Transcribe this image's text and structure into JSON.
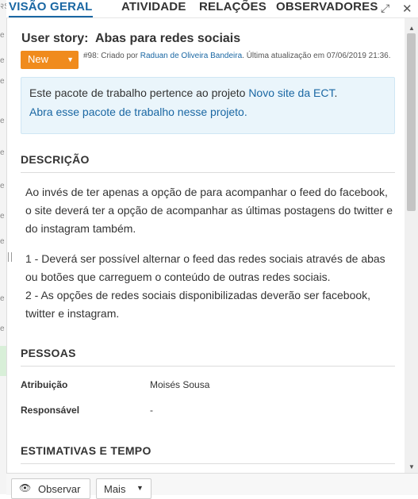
{
  "tabs": {
    "overview": "VISÃO GERAL",
    "activity": "ATIVIDADE",
    "relations": "RELAÇÕES",
    "watchers": "OBSERVADORES"
  },
  "header": {
    "type": "User story:",
    "title": "Abas para redes sociais"
  },
  "status": {
    "label": "New",
    "color": "#f08b1d"
  },
  "meta": {
    "prefix": "#98: Criado por ",
    "author": "Raduan de Oliveira Bandeira",
    "updated": ". Última atualização em 07/06/2019 21:36."
  },
  "notice": {
    "line1_prefix": "Este pacote de trabalho pertence ao projeto ",
    "project": "Novo site da ECT",
    "line1_suffix": ".",
    "open_link": "Abra esse pacote de trabalho nesse projeto."
  },
  "description": {
    "heading": "DESCRIÇÃO",
    "p1": "Ao invés de ter apenas a opção de para acompanhar o feed do facebook, o site deverá ter a opção de acompanhar as últimas postagens do twitter e do instagram também.",
    "p2_line1": "1 - Deverá ser possível alternar o feed das redes sociais através de abas ou botões que carreguem o conteúdo de outras redes sociais.",
    "p2_line2": "2 - As opções de redes sociais disponibilizadas deverão ser facebook, twitter e instagram."
  },
  "people": {
    "heading": "PESSOAS",
    "assignee_label": "Atribuição",
    "assignee_value": "Moisés Sousa",
    "responsible_label": "Responsável",
    "responsible_value": "-"
  },
  "estimates": {
    "heading": "ESTIMATIVAS E TEMPO"
  },
  "footer": {
    "watch_label": "Observar",
    "more_label": "Mais"
  },
  "left_edge": {
    "marks": [
      "२S",
      "e",
      "e",
      "e",
      "e",
      "e",
      "e",
      "e",
      "e",
      "e",
      "e",
      "e"
    ]
  },
  "colors": {
    "accent": "#1a67a3",
    "notice_bg": "#eaf5fb",
    "status": "#f08b1d"
  }
}
